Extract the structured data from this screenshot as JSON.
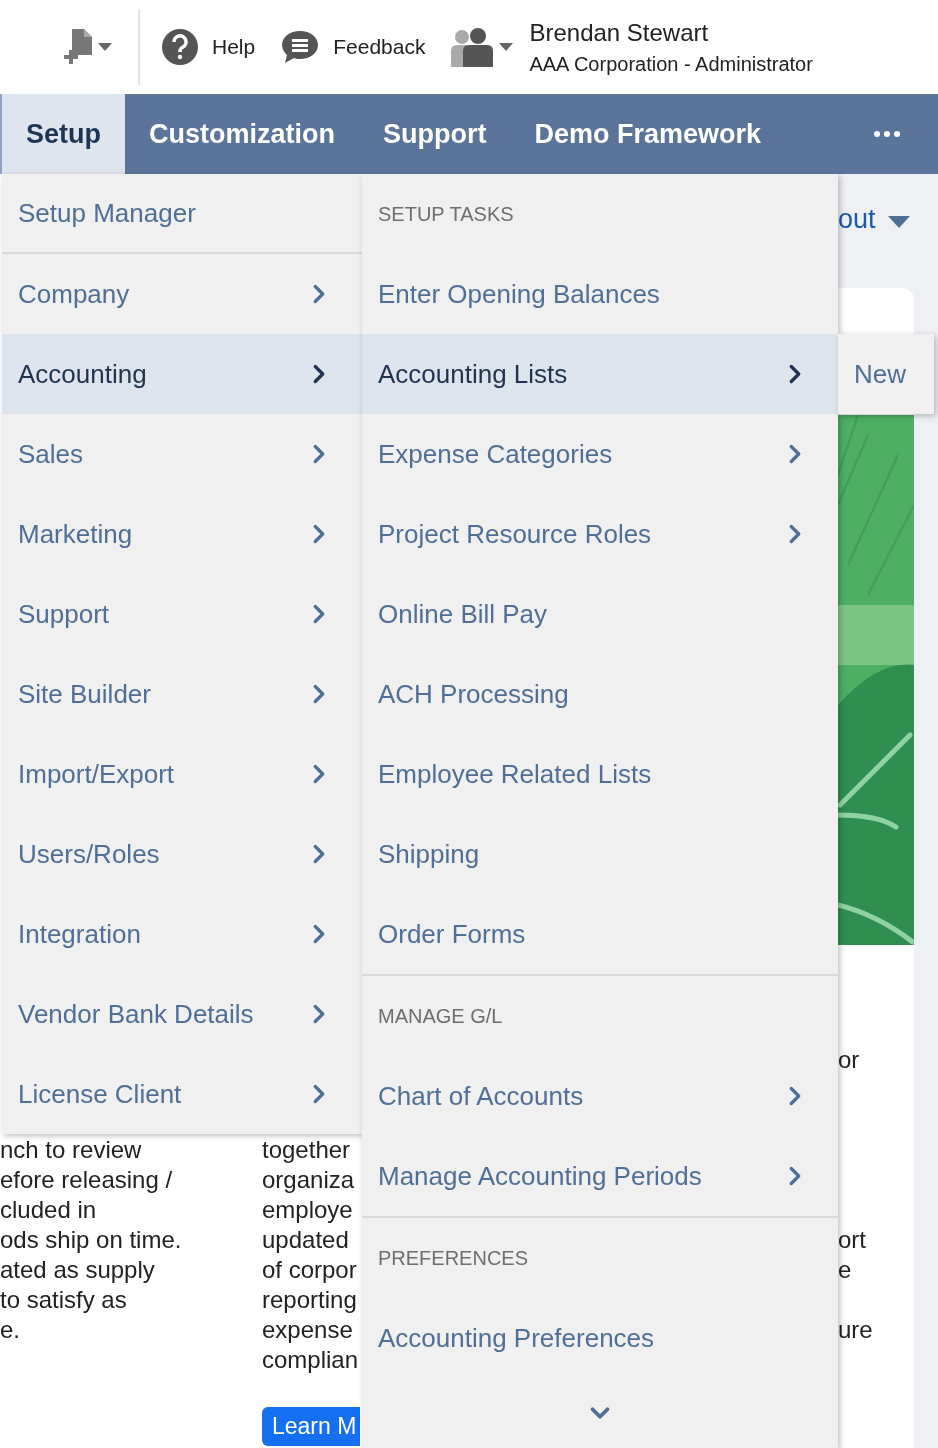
{
  "header": {
    "help": "Help",
    "feedback": "Feedback",
    "user_name": "Brendan Stewart",
    "user_role": "AAA Corporation - Administrator"
  },
  "nav_tabs": [
    {
      "label": "Setup",
      "selected": true
    },
    {
      "label": "Customization",
      "selected": false
    },
    {
      "label": "Support",
      "selected": false
    },
    {
      "label": "Demo Framework",
      "selected": false
    }
  ],
  "setup_menu": [
    {
      "label": "Setup Manager",
      "submenu": false,
      "selected": false
    },
    {
      "label": "Company",
      "submenu": true,
      "selected": false
    },
    {
      "label": "Accounting",
      "submenu": true,
      "selected": true
    },
    {
      "label": "Sales",
      "submenu": true,
      "selected": false
    },
    {
      "label": "Marketing",
      "submenu": true,
      "selected": false
    },
    {
      "label": "Support",
      "submenu": true,
      "selected": false
    },
    {
      "label": "Site Builder",
      "submenu": true,
      "selected": false
    },
    {
      "label": "Import/Export",
      "submenu": true,
      "selected": false
    },
    {
      "label": "Users/Roles",
      "submenu": true,
      "selected": false
    },
    {
      "label": "Integration",
      "submenu": true,
      "selected": false
    },
    {
      "label": "Vendor Bank Details",
      "submenu": true,
      "selected": false
    },
    {
      "label": "License Client",
      "submenu": true,
      "selected": false
    }
  ],
  "accounting_menu": [
    {
      "title": "SETUP TASKS",
      "items": [
        {
          "label": "Enter Opening Balances",
          "submenu": false,
          "selected": false
        },
        {
          "label": "Accounting Lists",
          "submenu": true,
          "selected": true
        },
        {
          "label": "Expense Categories",
          "submenu": true,
          "selected": false
        },
        {
          "label": "Project Resource Roles",
          "submenu": true,
          "selected": false
        },
        {
          "label": "Online Bill Pay",
          "submenu": false,
          "selected": false
        },
        {
          "label": "ACH Processing",
          "submenu": false,
          "selected": false
        },
        {
          "label": "Employee Related Lists",
          "submenu": false,
          "selected": false
        },
        {
          "label": "Shipping",
          "submenu": false,
          "selected": false
        },
        {
          "label": "Order Forms",
          "submenu": false,
          "selected": false
        }
      ]
    },
    {
      "title": "MANAGE G/L",
      "items": [
        {
          "label": "Chart of Accounts",
          "submenu": true,
          "selected": false
        },
        {
          "label": "Manage Accounting Periods",
          "submenu": true,
          "selected": false
        }
      ]
    },
    {
      "title": "PREFERENCES",
      "items": [
        {
          "label": "Accounting Preferences",
          "submenu": false,
          "selected": false
        }
      ]
    }
  ],
  "lists_menu": [
    {
      "label": "New",
      "submenu": false,
      "selected": false
    }
  ],
  "background": {
    "layout_link": "out",
    "left_lines": [
      "nch to review",
      "efore releasing /",
      "cluded in",
      "ods ship on time.",
      "ated as supply",
      "to satisfy as",
      "e."
    ],
    "middle_lines": [
      "together",
      "organiza",
      "employe",
      "updated",
      "of corpor",
      "reporting",
      "expense",
      "complian"
    ],
    "learn_more": "Learn M",
    "right_lines": [
      "or",
      "ort",
      "e",
      "ure"
    ]
  }
}
